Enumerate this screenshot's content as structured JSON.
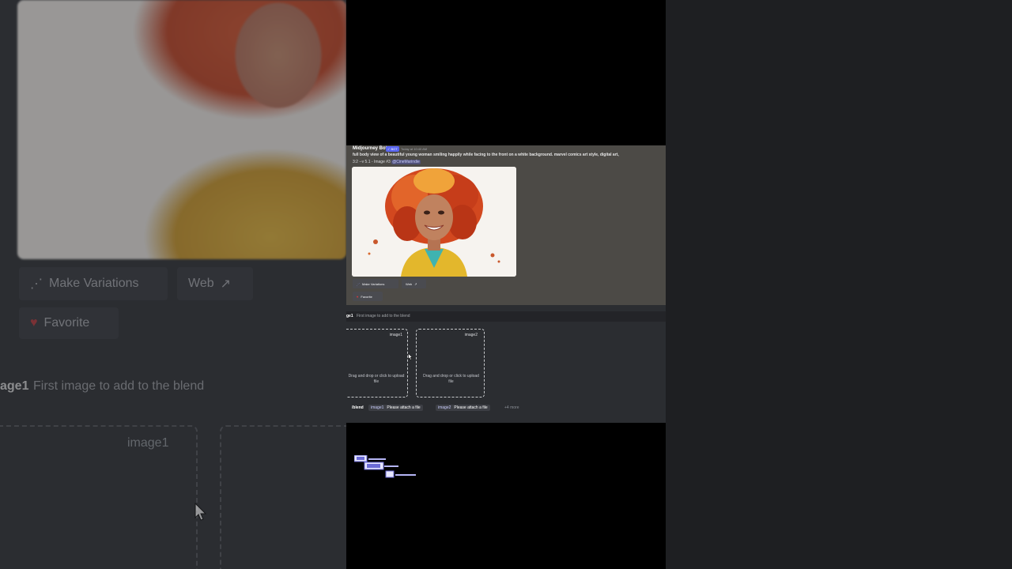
{
  "background_left": {
    "make_variations_label": "Make Variations",
    "web_label": "Web",
    "favorite_label": "Favorite",
    "option_name": "age1",
    "option_desc": "First image to add to the blend",
    "image1_label": "image1"
  },
  "message": {
    "author": "Midjourney Bot",
    "bot_tag": "✓ BOT",
    "timestamp": "Today at 10:40 AM",
    "prompt": "full body view of a beautiful young woman smiling happily while facing to the front on a white background. marvel comics art style, digital art,",
    "prompt_suffix": "3:2 --v 5.1",
    "image_number": " - Image #3 ",
    "mention": "@CineMarindie",
    "buttons": {
      "make_variations": "Make Variations",
      "web": "Web",
      "favorite": "Favorite"
    }
  },
  "blend": {
    "option_name": "ge1",
    "option_desc": "First image to add to the blend",
    "slots": [
      {
        "label": "image1",
        "hint": "Drag and drop or click to upload file"
      },
      {
        "label": "image2",
        "hint": "Drag and drop or click to upload file"
      }
    ],
    "command": "/blend",
    "params": [
      {
        "name": "image1",
        "value": "Please attach a file"
      },
      {
        "name": "image2",
        "value": "Please attach a file"
      }
    ],
    "more": "+4 more"
  },
  "colors": {
    "blurple": "#5865f2",
    "message_bg": "#4c4a46",
    "panel_bg": "#2b2d31",
    "favorite_heart": "#da373c"
  }
}
